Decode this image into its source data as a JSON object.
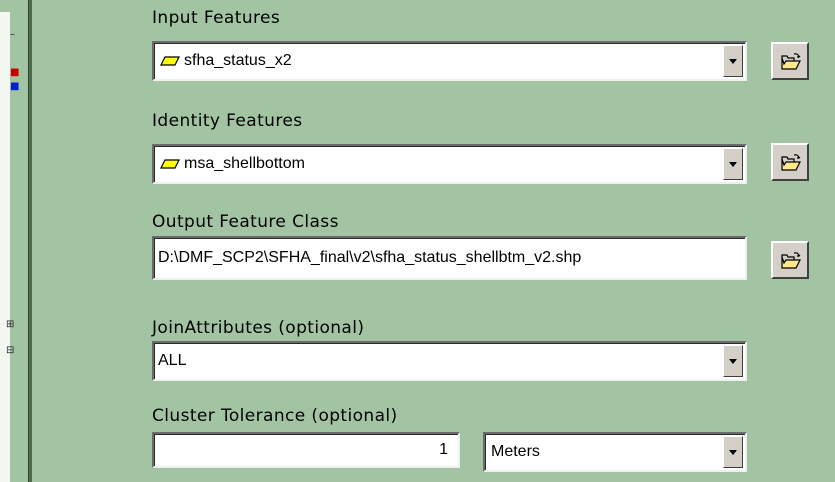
{
  "icons": {
    "layer": "polygon-layer-icon",
    "browse": "open-folder-icon",
    "dropdown": "chevron-down-icon"
  },
  "colors": {
    "panel_bg": "#a3c4a3",
    "layer_fill": "#ffff00"
  },
  "fields": {
    "input_features": {
      "label": "Input Features",
      "value": "sfha_status_x2"
    },
    "identity_features": {
      "label": "Identity Features",
      "value": "msa_shellbottom"
    },
    "output_feature_class": {
      "label": "Output Feature Class",
      "value": "D:\\DMF_SCP2\\SFHA_final\\v2\\sfha_status_shellbtm_v2.shp"
    },
    "join_attributes": {
      "label": "JoinAttributes (optional)",
      "value": "ALL"
    },
    "cluster_tolerance": {
      "label": "Cluster Tolerance (optional)",
      "value": "1",
      "units": "Meters"
    }
  }
}
